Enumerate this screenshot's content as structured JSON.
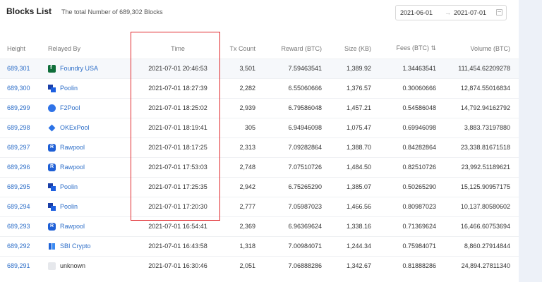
{
  "header": {
    "title": "Blocks List",
    "subtitle": "The total Number of 689,302 Blocks"
  },
  "date_range": {
    "start": "2021-06-01",
    "arrow": "→",
    "end": "2021-07-01"
  },
  "columns": {
    "height": "Height",
    "pool": "Relayed By",
    "time": "Time",
    "tx": "Tx Count",
    "reward": "Reward (BTC)",
    "size": "Size (KB)",
    "fees": "Fees (BTC) ⇅",
    "volume": "Volume (BTC)"
  },
  "rows": [
    {
      "height": "689,301",
      "pool": "Foundry USA",
      "icon": "foundry-usa-icon",
      "time": "2021-07-01 20:46:53",
      "tx": "3,501",
      "reward": "7.59463541",
      "size": "1,389.92",
      "fees": "1.34463541",
      "volume": "111,454.62209278"
    },
    {
      "height": "689,300",
      "pool": "Poolin",
      "icon": "poolin-icon",
      "time": "2021-07-01 18:27:39",
      "tx": "2,282",
      "reward": "6.55060666",
      "size": "1,376.57",
      "fees": "0.30060666",
      "volume": "12,874.55016834"
    },
    {
      "height": "689,299",
      "pool": "F2Pool",
      "icon": "f2pool-icon",
      "time": "2021-07-01 18:25:02",
      "tx": "2,939",
      "reward": "6.79586048",
      "size": "1,457.21",
      "fees": "0.54586048",
      "volume": "14,792.94162792"
    },
    {
      "height": "689,298",
      "pool": "OKExPool",
      "icon": "okexpool-icon",
      "time": "2021-07-01 18:19:41",
      "tx": "305",
      "reward": "6.94946098",
      "size": "1,075.47",
      "fees": "0.69946098",
      "volume": "3,883.73197880"
    },
    {
      "height": "689,297",
      "pool": "Rawpool",
      "icon": "rawpool-icon",
      "time": "2021-07-01 18:17:25",
      "tx": "2,313",
      "reward": "7.09282864",
      "size": "1,388.70",
      "fees": "0.84282864",
      "volume": "23,338.81671518"
    },
    {
      "height": "689,296",
      "pool": "Rawpool",
      "icon": "rawpool-icon",
      "time": "2021-07-01 17:53:03",
      "tx": "2,748",
      "reward": "7.07510726",
      "size": "1,484.50",
      "fees": "0.82510726",
      "volume": "23,992.51189621"
    },
    {
      "height": "689,295",
      "pool": "Poolin",
      "icon": "poolin-icon",
      "time": "2021-07-01 17:25:35",
      "tx": "2,942",
      "reward": "6.75265290",
      "size": "1,385.07",
      "fees": "0.50265290",
      "volume": "15,125.90957175"
    },
    {
      "height": "689,294",
      "pool": "Poolin",
      "icon": "poolin-icon",
      "time": "2021-07-01 17:20:30",
      "tx": "2,777",
      "reward": "7.05987023",
      "size": "1,466.56",
      "fees": "0.80987023",
      "volume": "10,137.80580602"
    },
    {
      "height": "689,293",
      "pool": "Rawpool",
      "icon": "rawpool-icon",
      "time": "2021-07-01 16:54:41",
      "tx": "2,369",
      "reward": "6.96369624",
      "size": "1,338.16",
      "fees": "0.71369624",
      "volume": "16,466.60753694"
    },
    {
      "height": "689,292",
      "pool": "SBI Crypto",
      "icon": "sbi-crypto-icon",
      "time": "2021-07-01 16:43:58",
      "tx": "1,318",
      "reward": "7.00984071",
      "size": "1,244.34",
      "fees": "0.75984071",
      "volume": "8,860.27914844"
    },
    {
      "height": "689,291",
      "pool": "unknown",
      "icon": "unknown-pool-icon",
      "time": "2021-07-01 16:30:46",
      "tx": "2,051",
      "reward": "7.06888286",
      "size": "1,342.67",
      "fees": "0.81888286",
      "volume": "24,894.27811340"
    }
  ],
  "colors": {
    "link": "#2d6ec8",
    "highlight_box": "#e0262a"
  }
}
